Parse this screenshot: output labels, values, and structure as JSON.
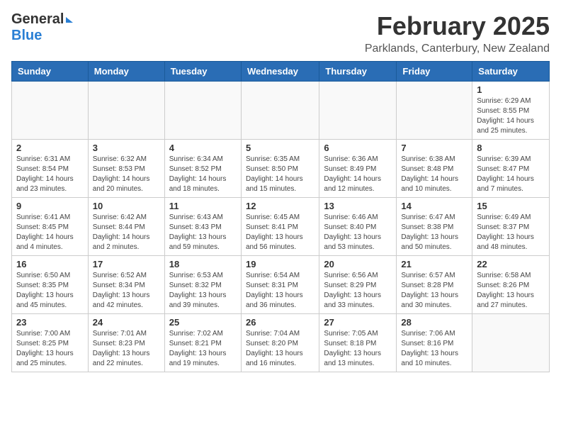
{
  "header": {
    "logo_general": "General",
    "logo_blue": "Blue",
    "month": "February 2025",
    "location": "Parklands, Canterbury, New Zealand"
  },
  "days_of_week": [
    "Sunday",
    "Monday",
    "Tuesday",
    "Wednesday",
    "Thursday",
    "Friday",
    "Saturday"
  ],
  "weeks": [
    [
      {
        "day": "",
        "info": ""
      },
      {
        "day": "",
        "info": ""
      },
      {
        "day": "",
        "info": ""
      },
      {
        "day": "",
        "info": ""
      },
      {
        "day": "",
        "info": ""
      },
      {
        "day": "",
        "info": ""
      },
      {
        "day": "1",
        "info": "Sunrise: 6:29 AM\nSunset: 8:55 PM\nDaylight: 14 hours\nand 25 minutes."
      }
    ],
    [
      {
        "day": "2",
        "info": "Sunrise: 6:31 AM\nSunset: 8:54 PM\nDaylight: 14 hours\nand 23 minutes."
      },
      {
        "day": "3",
        "info": "Sunrise: 6:32 AM\nSunset: 8:53 PM\nDaylight: 14 hours\nand 20 minutes."
      },
      {
        "day": "4",
        "info": "Sunrise: 6:34 AM\nSunset: 8:52 PM\nDaylight: 14 hours\nand 18 minutes."
      },
      {
        "day": "5",
        "info": "Sunrise: 6:35 AM\nSunset: 8:50 PM\nDaylight: 14 hours\nand 15 minutes."
      },
      {
        "day": "6",
        "info": "Sunrise: 6:36 AM\nSunset: 8:49 PM\nDaylight: 14 hours\nand 12 minutes."
      },
      {
        "day": "7",
        "info": "Sunrise: 6:38 AM\nSunset: 8:48 PM\nDaylight: 14 hours\nand 10 minutes."
      },
      {
        "day": "8",
        "info": "Sunrise: 6:39 AM\nSunset: 8:47 PM\nDaylight: 14 hours\nand 7 minutes."
      }
    ],
    [
      {
        "day": "9",
        "info": "Sunrise: 6:41 AM\nSunset: 8:45 PM\nDaylight: 14 hours\nand 4 minutes."
      },
      {
        "day": "10",
        "info": "Sunrise: 6:42 AM\nSunset: 8:44 PM\nDaylight: 14 hours\nand 2 minutes."
      },
      {
        "day": "11",
        "info": "Sunrise: 6:43 AM\nSunset: 8:43 PM\nDaylight: 13 hours\nand 59 minutes."
      },
      {
        "day": "12",
        "info": "Sunrise: 6:45 AM\nSunset: 8:41 PM\nDaylight: 13 hours\nand 56 minutes."
      },
      {
        "day": "13",
        "info": "Sunrise: 6:46 AM\nSunset: 8:40 PM\nDaylight: 13 hours\nand 53 minutes."
      },
      {
        "day": "14",
        "info": "Sunrise: 6:47 AM\nSunset: 8:38 PM\nDaylight: 13 hours\nand 50 minutes."
      },
      {
        "day": "15",
        "info": "Sunrise: 6:49 AM\nSunset: 8:37 PM\nDaylight: 13 hours\nand 48 minutes."
      }
    ],
    [
      {
        "day": "16",
        "info": "Sunrise: 6:50 AM\nSunset: 8:35 PM\nDaylight: 13 hours\nand 45 minutes."
      },
      {
        "day": "17",
        "info": "Sunrise: 6:52 AM\nSunset: 8:34 PM\nDaylight: 13 hours\nand 42 minutes."
      },
      {
        "day": "18",
        "info": "Sunrise: 6:53 AM\nSunset: 8:32 PM\nDaylight: 13 hours\nand 39 minutes."
      },
      {
        "day": "19",
        "info": "Sunrise: 6:54 AM\nSunset: 8:31 PM\nDaylight: 13 hours\nand 36 minutes."
      },
      {
        "day": "20",
        "info": "Sunrise: 6:56 AM\nSunset: 8:29 PM\nDaylight: 13 hours\nand 33 minutes."
      },
      {
        "day": "21",
        "info": "Sunrise: 6:57 AM\nSunset: 8:28 PM\nDaylight: 13 hours\nand 30 minutes."
      },
      {
        "day": "22",
        "info": "Sunrise: 6:58 AM\nSunset: 8:26 PM\nDaylight: 13 hours\nand 27 minutes."
      }
    ],
    [
      {
        "day": "23",
        "info": "Sunrise: 7:00 AM\nSunset: 8:25 PM\nDaylight: 13 hours\nand 25 minutes."
      },
      {
        "day": "24",
        "info": "Sunrise: 7:01 AM\nSunset: 8:23 PM\nDaylight: 13 hours\nand 22 minutes."
      },
      {
        "day": "25",
        "info": "Sunrise: 7:02 AM\nSunset: 8:21 PM\nDaylight: 13 hours\nand 19 minutes."
      },
      {
        "day": "26",
        "info": "Sunrise: 7:04 AM\nSunset: 8:20 PM\nDaylight: 13 hours\nand 16 minutes."
      },
      {
        "day": "27",
        "info": "Sunrise: 7:05 AM\nSunset: 8:18 PM\nDaylight: 13 hours\nand 13 minutes."
      },
      {
        "day": "28",
        "info": "Sunrise: 7:06 AM\nSunset: 8:16 PM\nDaylight: 13 hours\nand 10 minutes."
      },
      {
        "day": "",
        "info": ""
      }
    ]
  ]
}
